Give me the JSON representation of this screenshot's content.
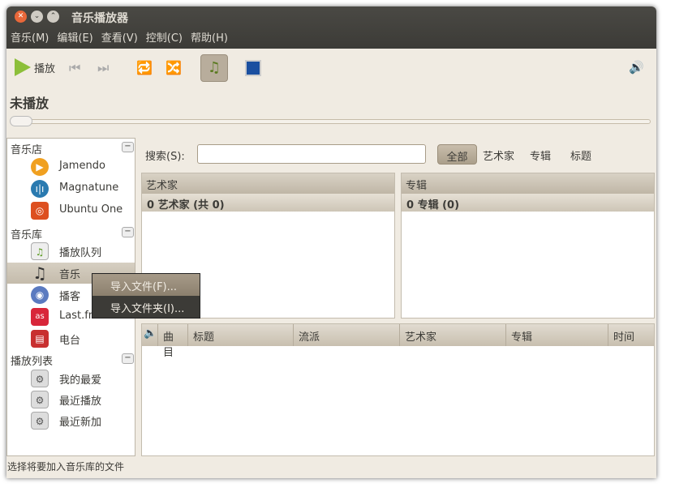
{
  "window": {
    "title": "音乐播放器"
  },
  "menubar": [
    "音乐(M)",
    "编辑(E)",
    "查看(V)",
    "控制(C)",
    "帮助(H)"
  ],
  "toolbar": {
    "play_label": "播放"
  },
  "now_playing": "未播放",
  "sidebar": {
    "sections": [
      {
        "label": "音乐店",
        "items": [
          "Jamendo",
          "Magnatune",
          "Ubuntu One"
        ]
      },
      {
        "label": "音乐库",
        "items": [
          "播放队列",
          "音乐",
          "播客",
          "Last.fm",
          "电台"
        ]
      },
      {
        "label": "播放列表",
        "items": [
          "我的最爱",
          "最近播放",
          "最近新加"
        ]
      }
    ]
  },
  "context_menu": [
    "导入文件(F)...",
    "导入文件夹(I)..."
  ],
  "search": {
    "label": "搜索(S):",
    "value": ""
  },
  "filters": [
    "全部",
    "艺术家",
    "专辑",
    "标题"
  ],
  "browser": {
    "artist_header": "艺术家",
    "artist_summary": "0 艺术家 (共 0)",
    "album_header": "专辑",
    "album_summary": "0 专辑 (0)"
  },
  "tracklist": {
    "columns": [
      "曲目",
      "标题",
      "流派",
      "艺术家",
      "专辑",
      "时间"
    ]
  },
  "statusbar": "选择将要加入音乐库的文件"
}
